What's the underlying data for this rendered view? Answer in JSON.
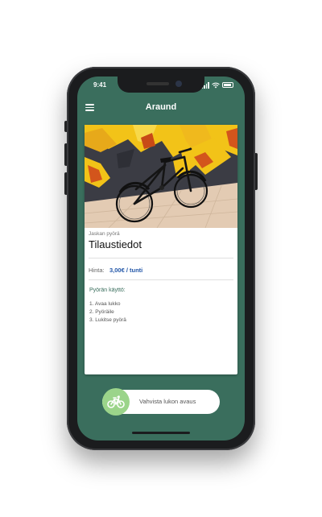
{
  "status_bar": {
    "time": "9:41"
  },
  "header": {
    "title": "Araund",
    "menu_icon": "hamburger-menu-icon"
  },
  "card": {
    "photo_icon": "bicycle-photo",
    "owner": "Jaskan pyörä",
    "title": "Tilaustiedot",
    "price_label": "Hinta:",
    "price_value": "3,00€ / tunti",
    "usage_title": "Pyörän käyttö:",
    "steps": [
      "1. Avaa lukko",
      "2. Pyöräile",
      "3. Lukitse pyörä"
    ]
  },
  "swipe": {
    "label": "Vahvista lukon avaus",
    "icon": "bicycle-icon"
  },
  "colors": {
    "primary": "#3a6e5d",
    "accent_green": "#9bd48a",
    "price_blue": "#2256a8",
    "graffiti_yellow": "#f2c318",
    "graffiti_dark": "#3b3c44"
  }
}
